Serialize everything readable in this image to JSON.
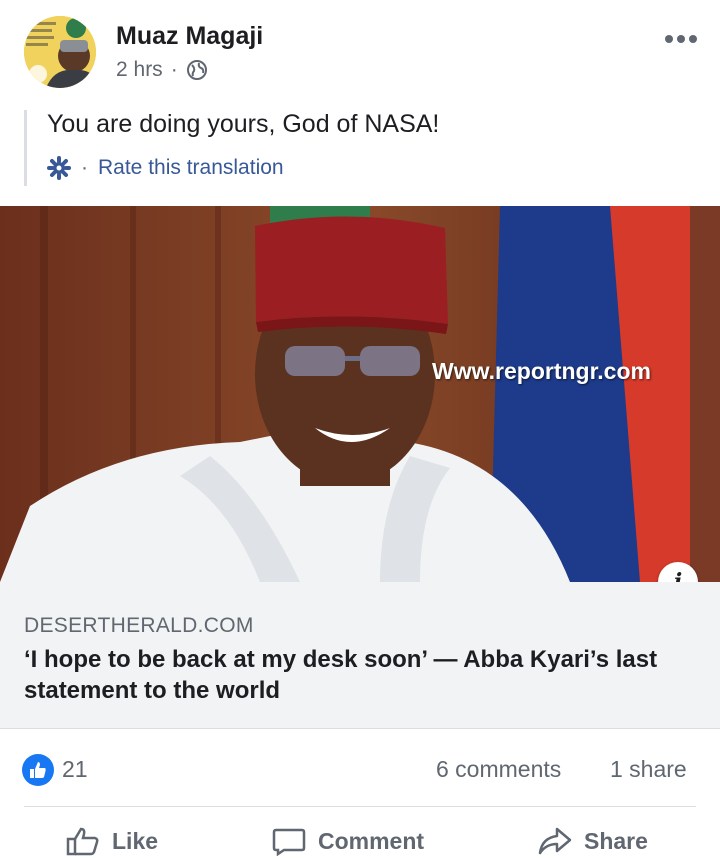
{
  "post": {
    "author": "Muaz Magaji",
    "time": "2 hrs",
    "separator": "·",
    "text": "You are doing yours, God of NASA!",
    "rate_translation": "Rate this translation",
    "translate_separator": "·"
  },
  "photo": {
    "watermark": "Www.reportngr.com",
    "info_icon_glyph": "i"
  },
  "link": {
    "domain": "DESERTHERALD.COM",
    "headline": "‘I hope to be back at my desk soon’ — Abba Kyari’s last statement to the world"
  },
  "stats": {
    "reactions": "21",
    "comments": "6 comments",
    "shares": "1 share"
  },
  "actions": {
    "like": "Like",
    "comment": "Comment",
    "share": "Share"
  },
  "icons": [
    "more-icon",
    "globe-icon",
    "gear-icon",
    "info-icon",
    "thumbs-up-icon",
    "like-icon",
    "comment-icon",
    "share-icon"
  ],
  "colors": {
    "link_blue": "#385898",
    "like_blue": "#1877f2",
    "muted_text": "#606770",
    "link_box_bg": "#f2f3f5"
  }
}
